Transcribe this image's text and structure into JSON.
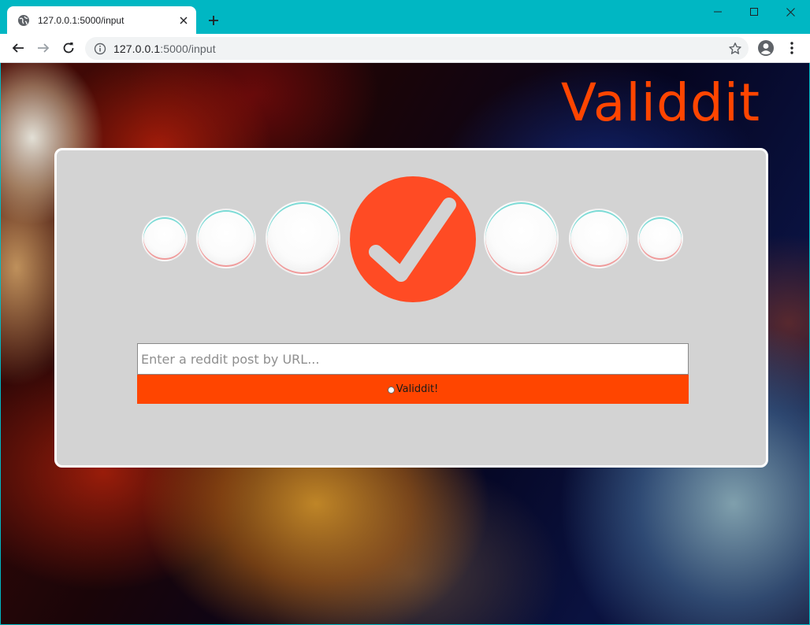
{
  "browser": {
    "tab_title": "127.0.0.1:5000/input",
    "url_host": "127.0.0.1",
    "url_path": ":5000/input"
  },
  "page": {
    "logo_text": "Validdit",
    "input_placeholder": "Enter a reddit post by URL...",
    "input_value": "",
    "submit_label": "Validdit!"
  },
  "colors": {
    "accent": "#ff4500",
    "card_bg": "#d3d3d3",
    "chrome_bg": "#00b7c3"
  },
  "icons": {
    "tab_favicon": "globe-icon",
    "tab_close": "close-icon",
    "new_tab": "plus-icon",
    "back": "arrow-left-icon",
    "forward": "arrow-right-icon",
    "reload": "reload-icon",
    "site_info": "info-icon",
    "bookmark": "star-icon",
    "profile": "profile-icon",
    "menu": "kebab-menu-icon",
    "hero": "checkmark-icon"
  }
}
